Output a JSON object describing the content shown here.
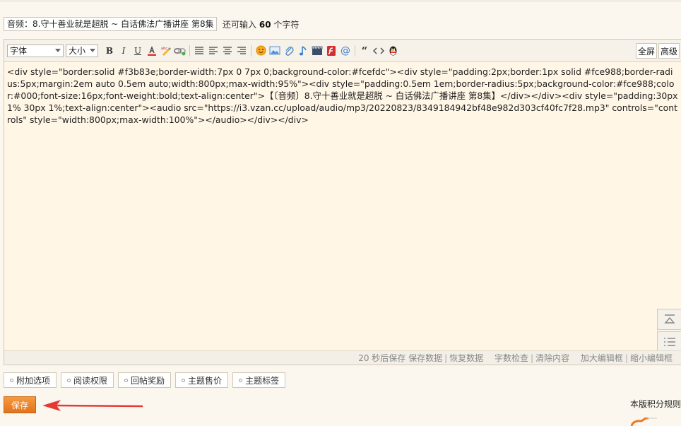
{
  "subject": {
    "value": "音频：8.守十善业就是超脱 ~ 白话佛法广播讲座 第8集",
    "remaining_prefix": "还可输入",
    "remaining_count": "60",
    "remaining_suffix": "个字符"
  },
  "toolbar": {
    "font_select": "字体",
    "size_select": "大小",
    "bold": "B",
    "italic": "I",
    "underline": "U",
    "fullscreen": "全屏",
    "advanced": "高级",
    "icons": [
      "font-color-icon",
      "spellcheck-icon",
      "link-icon",
      "align-justify-icon",
      "align-left-icon",
      "align-center-icon",
      "align-right-icon",
      "emoji-icon",
      "image-icon",
      "attachment-icon",
      "music-icon",
      "video-icon",
      "flash-icon",
      "mention-icon",
      "quote-icon",
      "code-icon",
      "qq-icon"
    ]
  },
  "editor": {
    "content": "<div style=\"border:solid #f3b83e;border-width:7px 0 7px 0;background-color:#fcefdc\"><div style=\"padding:2px;border:1px solid #fce988;border-radius:5px;margin:2em auto 0.5em auto;width:800px;max-width:95%\"><div style=\"padding:0.5em 1em;border-radius:5px;background-color:#fce988;color:#000;font-size:16px;font-weight:bold;text-align:center\">【〔音频〕8.守十善业就是超脱 ~ 白话佛法广播讲座 第8集】</div></div><div style=\"padding:30px 1% 30px 1%;text-align:center\"><audio src=\"https://i3.vzan.cc/upload/audio/mp3/20220823/8349184942bf48e982d303cf40fc7f28.mp3\" controls=\"controls\" style=\"width:800px;max-width:100%\"></audio></div></div>"
  },
  "status": {
    "autosave": "20 秒后保存",
    "save_data": "保存数据",
    "restore_data": "恢复数据",
    "word_check": "字数检查",
    "clear_content": "清除内容",
    "enlarge": "加大编辑框",
    "shrink": "缩小编辑框"
  },
  "options": [
    "附加选项",
    "阅读权限",
    "回帖奖励",
    "主题售价",
    "主题标签"
  ],
  "actions": {
    "save": "保存",
    "rules": "本版积分规则"
  },
  "colors": {
    "accent": "#e8792a",
    "arrow": "#e53935",
    "editor_bg": "#fff6e6"
  }
}
